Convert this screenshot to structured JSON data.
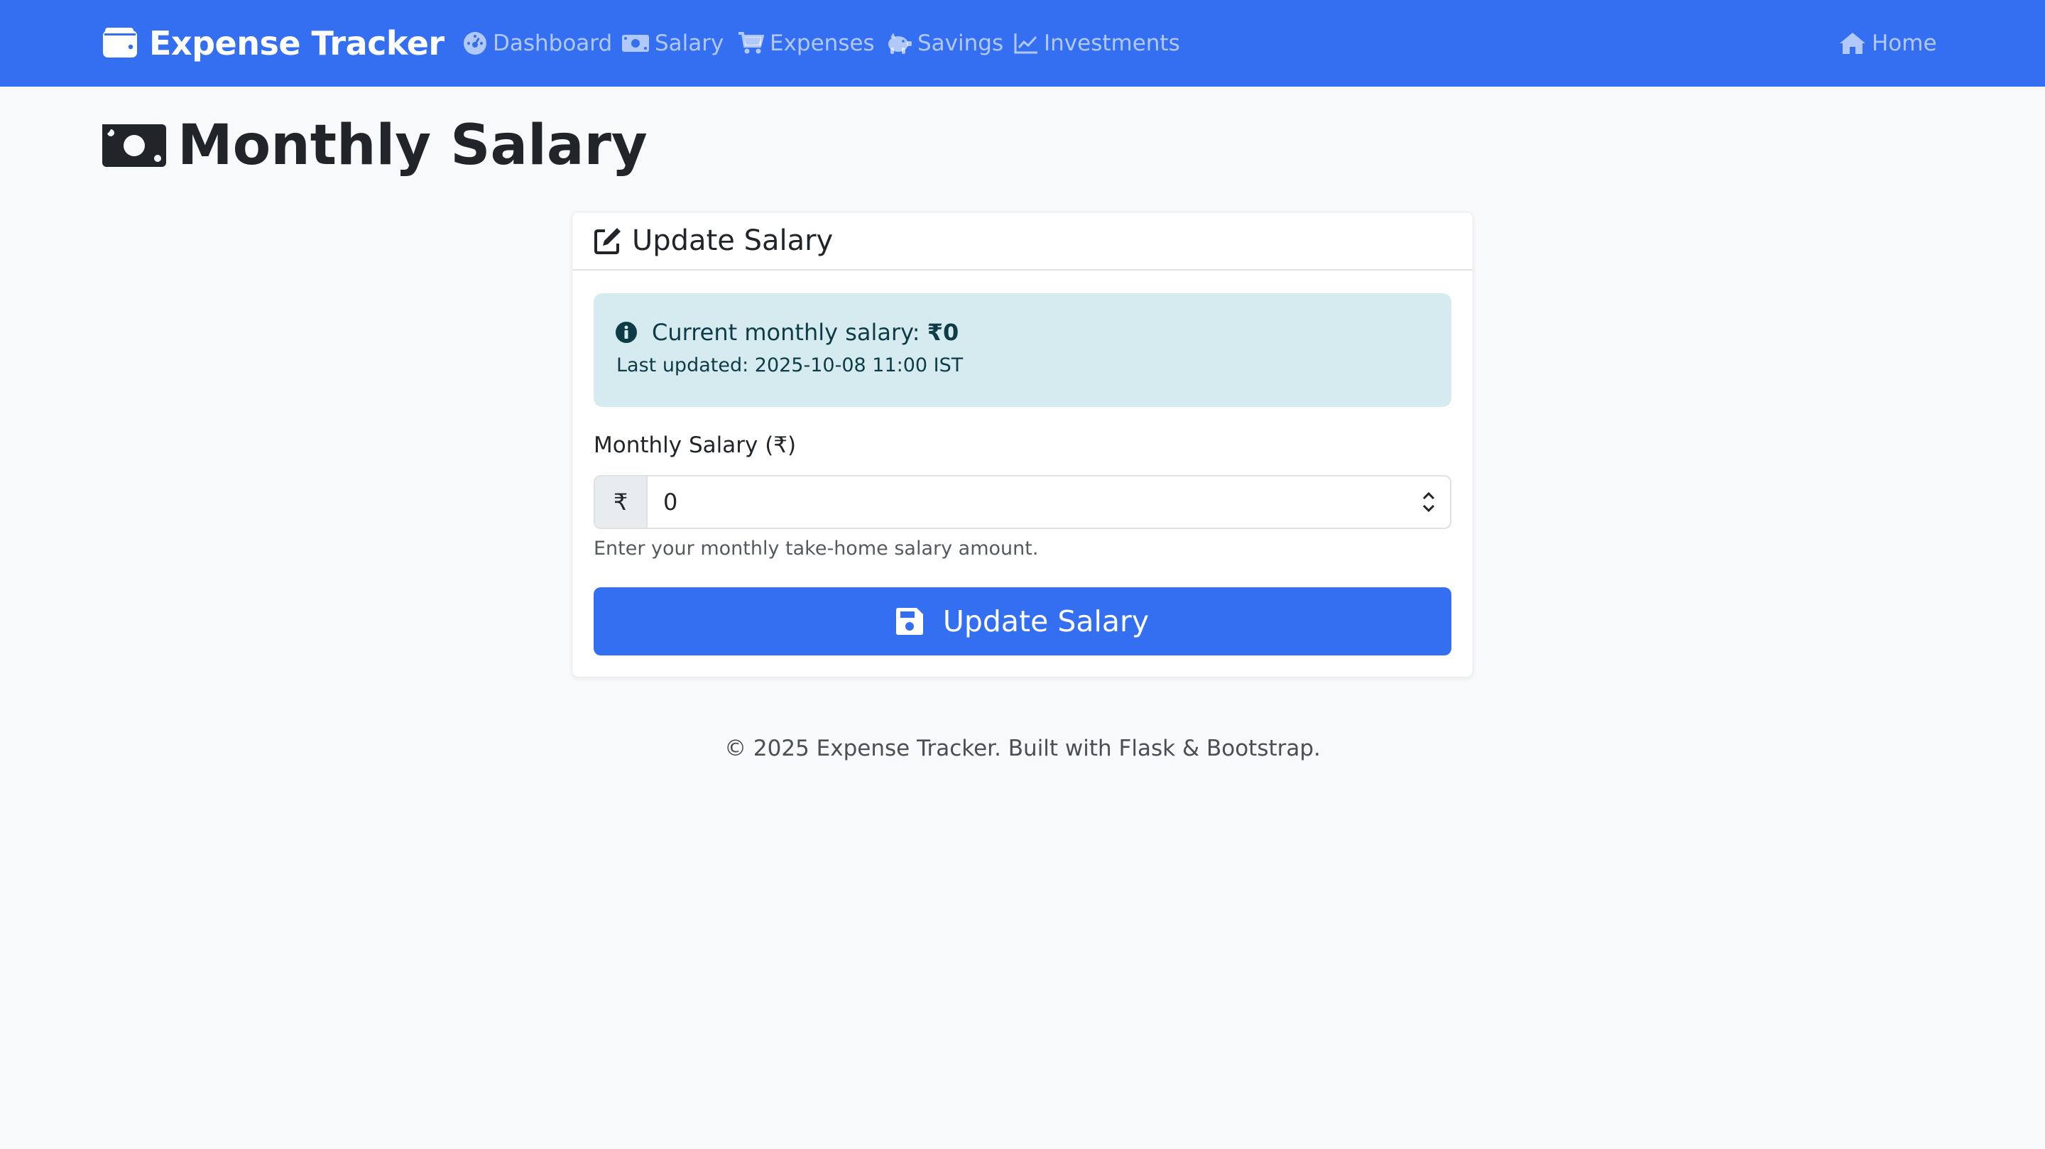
{
  "navbar": {
    "brand": "Expense Tracker",
    "items": [
      {
        "label": "Dashboard",
        "icon": "dashboard-gauge-icon"
      },
      {
        "label": "Salary",
        "icon": "money-bill-icon"
      },
      {
        "label": "Expenses",
        "icon": "shopping-cart-icon"
      },
      {
        "label": "Savings",
        "icon": "piggy-bank-icon"
      },
      {
        "label": "Investments",
        "icon": "line-chart-icon"
      }
    ],
    "home": {
      "label": "Home",
      "icon": "home-icon"
    }
  },
  "page": {
    "title": "Monthly Salary",
    "title_icon": "money-bill-icon"
  },
  "card": {
    "header": "Update Salary",
    "header_icon": "edit-icon",
    "alert": {
      "icon": "info-circle-icon",
      "label": "Current monthly salary:",
      "amount": "₹0",
      "last_updated": "Last updated: 2025-10-08 11:00 IST"
    },
    "form": {
      "label": "Monthly Salary (₹)",
      "prefix": "₹",
      "value": "0",
      "help": "Enter your monthly take-home salary amount."
    },
    "submit": {
      "label": "Update Salary",
      "icon": "save-icon"
    }
  },
  "footer": "© 2025 Expense Tracker. Built with Flask & Bootstrap.",
  "colors": {
    "primary": "#346ff2",
    "background": "#f8f9fa",
    "alert_bg": "#d6ebf0",
    "alert_text": "#0d3c47"
  }
}
